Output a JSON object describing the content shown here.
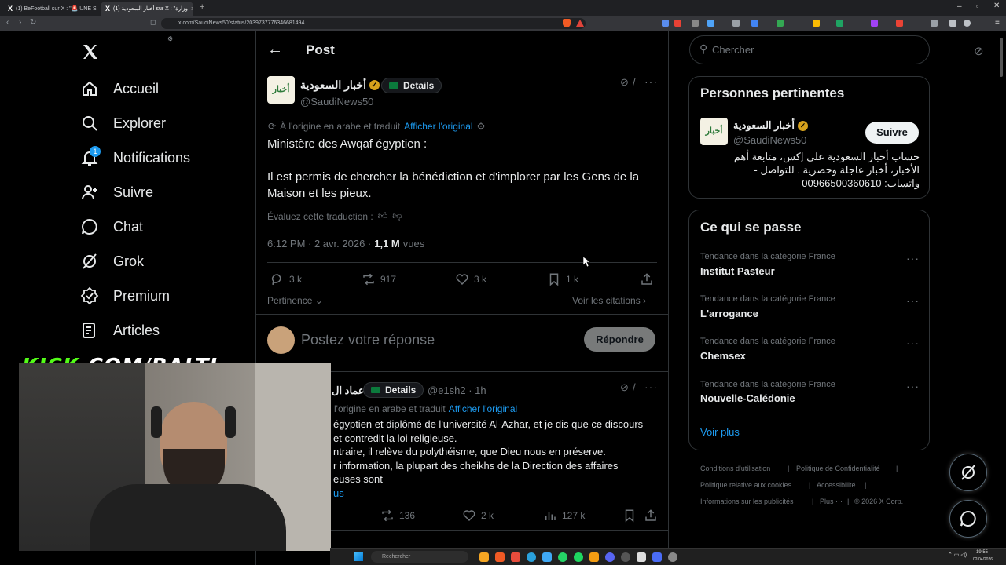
{
  "browser": {
    "tabs": [
      {
        "title": "(1) BeFootball sur X : \"🚨 UNE SCÈN"
      },
      {
        "title": "(1) أخبار السعودية sur X : \"وزارة"
      }
    ],
    "url": "x.com/SaudiNews50/status/2039737776346681494"
  },
  "nav": {
    "items": [
      {
        "label": "Accueil",
        "icon": "home-icon"
      },
      {
        "label": "Explorer",
        "icon": "search-icon"
      },
      {
        "label": "Notifications",
        "icon": "bell-icon"
      },
      {
        "label": "Suivre",
        "icon": "follow-icon"
      },
      {
        "label": "Chat",
        "icon": "chat-icon"
      },
      {
        "label": "Grok",
        "icon": "grok-icon"
      },
      {
        "label": "Premium",
        "icon": "premium-icon"
      },
      {
        "label": "Articles",
        "icon": "articles-icon"
      }
    ],
    "notifications_badge": "1"
  },
  "overlay": {
    "kick_text": "KICK",
    "kick_suffix": ".COM/BALTI"
  },
  "post": {
    "header_title": "Post",
    "author_name": "أخبار السعودية",
    "author_handle": "@SaudiNews50",
    "details_label": "Details",
    "translated_note": "À l'origine en arabe et traduit",
    "show_original": "Afficher l'original",
    "text_line1": "Ministère des Awqaf égyptien :",
    "text_line2": "Il est permis de chercher la bénédiction et d'implorer par les Gens de la Maison et les pieux.",
    "rate_translation": "Évaluez cette traduction :",
    "time": "6:12 PM · 2 avr. 2026 ·",
    "views_count": "1,1 M",
    "views_label": "vues",
    "stats": {
      "replies": "3 k",
      "reposts": "917",
      "likes": "3 k",
      "bookmarks": "1 k"
    },
    "sort_label": "Pertinence",
    "quotes_label": "Voir les citations",
    "reply_placeholder": "Postez votre réponse",
    "reply_button": "Répondre"
  },
  "reply": {
    "author_name": "عماد ال",
    "details_label": "Details",
    "handle_time": "@e1sh2 · 1h",
    "translated_note": "l'origine en arabe et traduit",
    "show_original": "Afficher l'original",
    "lines": [
      "égyptien et diplômé de l'université Al-Azhar, et je dis que ce discours",
      "et contredit la loi religieuse.",
      "ntraire, il relève du polythéisme, que Dieu nous en préserve.",
      "r information, la plupart des cheikhs de la Direction des affaires",
      "euses sont"
    ],
    "more": "us",
    "stats": {
      "reposts": "136",
      "likes": "2 k",
      "views": "127 k"
    }
  },
  "search": {
    "placeholder": "Chercher"
  },
  "relevant": {
    "title": "Personnes pertinentes",
    "name": "أخبار السعودية",
    "handle": "@SaudiNews50",
    "follow_button": "Suivre",
    "bio": "حساب أخبار السعودية على إكس، متابعة أهم الأخبار، أخبار عاجلة وحصرية . للتواصل - واتساب: 00966500360610"
  },
  "trends": {
    "title": "Ce qui se passe",
    "items": [
      {
        "category": "Tendance dans la catégorie France",
        "name": "Institut Pasteur"
      },
      {
        "category": "Tendance dans la catégorie France",
        "name": "L'arrogance"
      },
      {
        "category": "Tendance dans la catégorie France",
        "name": "Chemsex"
      },
      {
        "category": "Tendance dans la catégorie France",
        "name": "Nouvelle-Calédonie"
      }
    ],
    "show_more": "Voir plus"
  },
  "footer": {
    "links": [
      "Conditions d'utilisation",
      "Politique de Confidentialité",
      "Politique relative aux cookies",
      "Accessibilité",
      "Informations sur les publicités",
      "Plus ···",
      "© 2026 X Corp."
    ]
  },
  "taskbar": {
    "search_placeholder": "Rechercher",
    "clock_time": "19:55",
    "clock_date": "02/04/2026"
  },
  "colors": {
    "accent": "#1d9bf0",
    "kick_green": "#53fc18",
    "gold_verified": "#d6a11c"
  }
}
